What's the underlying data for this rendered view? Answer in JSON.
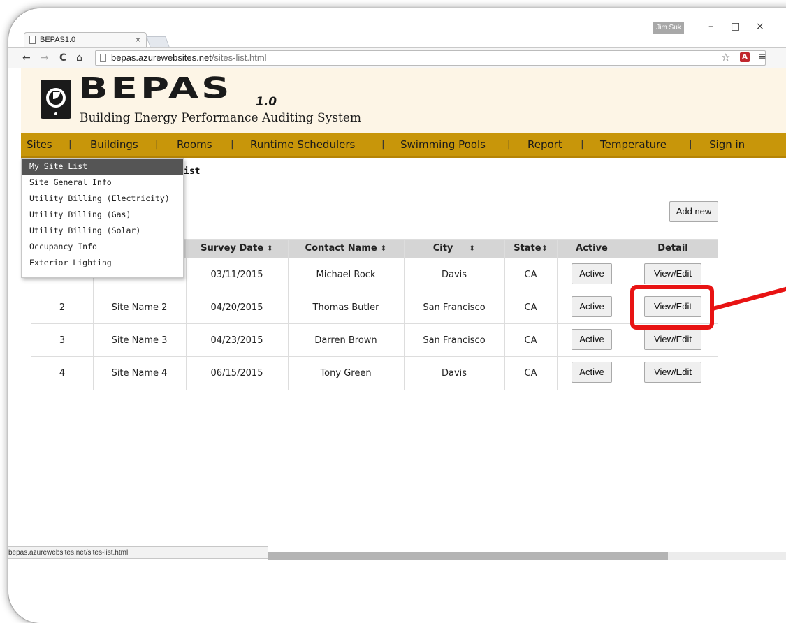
{
  "browser": {
    "tab_title": "BEPAS1.0",
    "tab_close": "×",
    "user_badge": "Jim Suk",
    "minimize": "–",
    "maximize": "□",
    "close": "×",
    "back": "←",
    "forward": "→",
    "reload": "C",
    "home": "⌂",
    "url_host": "bepas.azurewebsites.net",
    "url_path": "/sites-list.html",
    "star": "☆",
    "pdf": "A",
    "menu": "≡",
    "status_url": "bepas.azurewebsites.net/sites-list.html"
  },
  "logo": {
    "title": "BEPAS",
    "version": "1.0",
    "subtitle": "Building Energy Performance Auditing System"
  },
  "nav": {
    "items": [
      "Sites",
      "Buildings",
      "Rooms",
      "Runtime Schedulers",
      "Swimming Pools",
      "Report",
      "Temperature",
      "Sign in"
    ],
    "separator": "|"
  },
  "dropdown": {
    "items": [
      "My Site List",
      "Site General Info",
      "Utility Billing (Electricity)",
      "Utility Billing (Gas)",
      "Utility Billing (Solar)",
      "Occupancy Info",
      "Exterior Lighting"
    ],
    "active_index": 0
  },
  "page": {
    "heading_visible": "ist",
    "add_new": "Add new"
  },
  "table": {
    "columns": [
      "",
      "",
      "Survey Date",
      "Contact Name",
      "City",
      "State",
      "Active",
      "Detail"
    ],
    "sort_glyph": "⬍",
    "rows": [
      {
        "id": "",
        "name": "",
        "date": "03/11/2015",
        "contact": "Michael Rock",
        "city": "Davis",
        "state": "CA",
        "active": "Active",
        "detail": "View/Edit"
      },
      {
        "id": "2",
        "name": "Site Name 2",
        "date": "04/20/2015",
        "contact": "Thomas Butler",
        "city": "San Francisco",
        "state": "CA",
        "active": "Active",
        "detail": "View/Edit"
      },
      {
        "id": "3",
        "name": "Site Name 3",
        "date": "04/23/2015",
        "contact": "Darren Brown",
        "city": "San Francisco",
        "state": "CA",
        "active": "Active",
        "detail": "View/Edit"
      },
      {
        "id": "4",
        "name": "Site Name 4",
        "date": "06/15/2015",
        "contact": "Tony Green",
        "city": "Davis",
        "state": "CA",
        "active": "Active",
        "detail": "View/Edit"
      }
    ]
  },
  "colors": {
    "navbar": "#c8960a",
    "banner": "#fdf5e6",
    "highlight": "#e81313",
    "table_header": "#d5d5d5"
  }
}
